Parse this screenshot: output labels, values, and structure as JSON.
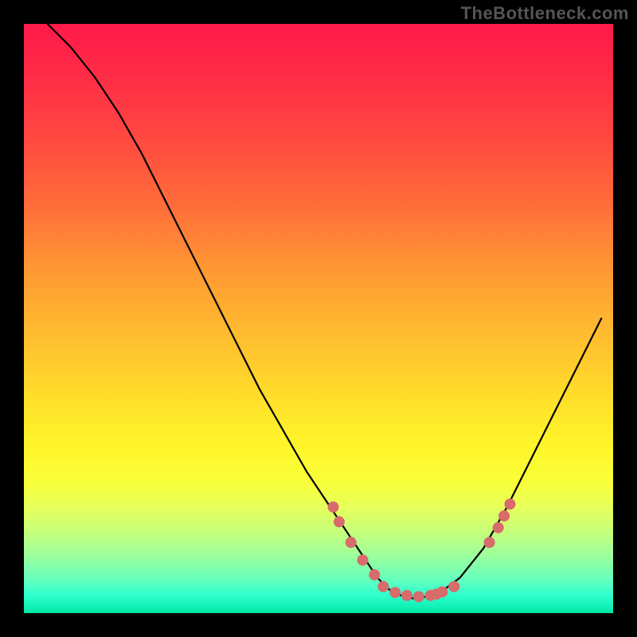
{
  "watermark": "TheBottleneck.com",
  "chart_data": {
    "type": "line",
    "title": "",
    "xlabel": "",
    "ylabel": "",
    "xlim": [
      0,
      100
    ],
    "ylim": [
      0,
      100
    ],
    "grid": false,
    "legend": false,
    "curve": {
      "name": "bottleneck-curve",
      "x": [
        4,
        8,
        12,
        16,
        20,
        24,
        28,
        32,
        36,
        40,
        44,
        48,
        52,
        56,
        58,
        60,
        62,
        64,
        66,
        70,
        74,
        78,
        82,
        86,
        90,
        94,
        98
      ],
      "y": [
        100,
        96,
        91,
        85,
        78,
        70,
        62,
        54,
        46,
        38,
        31,
        24,
        18,
        12,
        9,
        6,
        4,
        3,
        2.5,
        3,
        6,
        11,
        18,
        26,
        34,
        42,
        50
      ]
    },
    "scatter": {
      "name": "sample-points",
      "x": [
        52.5,
        53.5,
        55.5,
        57.5,
        59.5,
        61.0,
        63.0,
        65.0,
        67.0,
        69.0,
        70.0,
        71.0,
        73.0,
        79.0,
        80.5,
        81.5,
        82.5
      ],
      "y": [
        18.0,
        15.5,
        12.0,
        9.0,
        6.5,
        4.5,
        3.5,
        3.0,
        2.8,
        3.0,
        3.2,
        3.6,
        4.5,
        12.0,
        14.5,
        16.5,
        18.5
      ]
    },
    "colormap": "red-yellow-green vertical gradient (red high, green low)"
  }
}
